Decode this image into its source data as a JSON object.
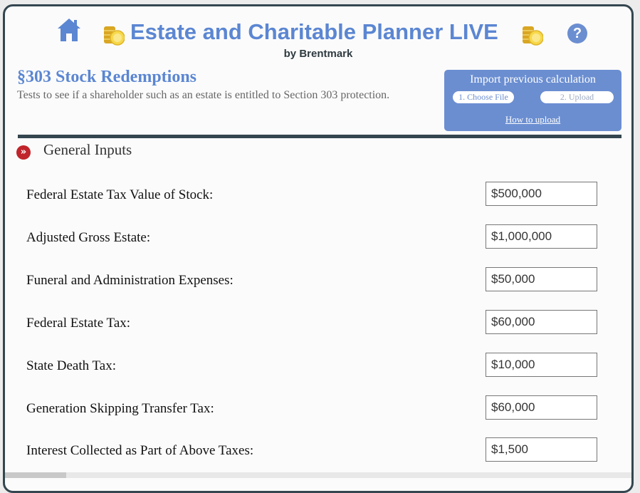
{
  "app": {
    "title": "Estate and Charitable Planner LIVE",
    "byline": "by Brentmark",
    "help_glyph": "?"
  },
  "page": {
    "title": "§303 Stock Redemptions",
    "description": "Tests to see if a shareholder such as an estate is entitled to Section 303 protection."
  },
  "import": {
    "title": "Import previous calculation",
    "choose_file": "1. Choose File",
    "upload": "2. Upload",
    "how_to": "How to upload"
  },
  "section": {
    "title": "General Inputs",
    "icon_glyph": "»"
  },
  "fields": [
    {
      "label": "Federal Estate Tax Value of Stock:",
      "value": "$500,000"
    },
    {
      "label": "Adjusted Gross Estate:",
      "value": "$1,000,000"
    },
    {
      "label": "Funeral and Administration Expenses:",
      "value": "$50,000"
    },
    {
      "label": "Federal Estate Tax:",
      "value": "$60,000"
    },
    {
      "label": "State Death Tax:",
      "value": "$10,000"
    },
    {
      "label": "Generation Skipping Transfer Tax:",
      "value": "$60,000"
    },
    {
      "label": "Interest Collected as Part of Above Taxes:",
      "value": "$1,500"
    }
  ],
  "icons": {
    "home": "home-icon",
    "coins": "coin-stack-icon",
    "help": "help-icon",
    "section": "double-chevron-right-icon"
  },
  "colors": {
    "accent": "#5b86d2",
    "panel": "#6b8ed1",
    "frame": "#34464f",
    "section_icon": "#c0252b"
  }
}
